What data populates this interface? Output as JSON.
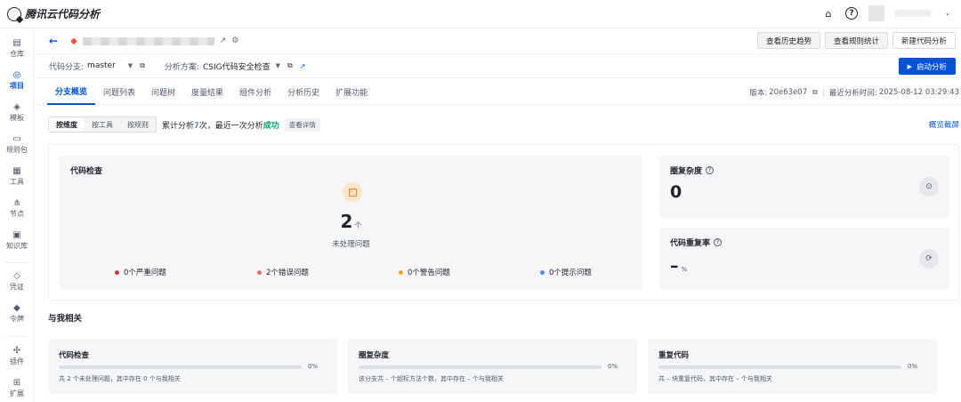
{
  "app": {
    "title": "腾讯云代码分析"
  },
  "nav": [
    {
      "label": "仓库",
      "icon": "repo-icon"
    },
    {
      "label": "项目",
      "icon": "project-icon",
      "active": true
    },
    {
      "label": "模板",
      "icon": "template-icon"
    },
    {
      "label": "规则包",
      "icon": "ruleset-icon"
    },
    {
      "label": "工具",
      "icon": "tools-icon"
    },
    {
      "label": "节点",
      "icon": "node-icon"
    },
    {
      "label": "知识库",
      "icon": "knowledge-icon"
    },
    {
      "label": "凭证",
      "icon": "credential-icon"
    },
    {
      "label": "令牌",
      "icon": "token-icon"
    },
    {
      "label": "插件",
      "icon": "plugin-icon"
    },
    {
      "label": "扩展",
      "icon": "extension-icon"
    }
  ],
  "header_buttons": {
    "history": "查看历史趋势",
    "rules": "查看规则统计",
    "new": "新建代码分析"
  },
  "branch": {
    "label": "代码分支:",
    "value": "master"
  },
  "scheme": {
    "label": "分析方案:",
    "value": "CSIG代码安全检查"
  },
  "start_button": "启动分析",
  "tabs": [
    "分支概览",
    "问题列表",
    "问题树",
    "度量结果",
    "组件分析",
    "分析历史",
    "扩展功能"
  ],
  "version": {
    "label": "版本:",
    "value": "20e63e07"
  },
  "last_analysis": {
    "label": "最近分析时间:",
    "value": "2025-08-12 03:29:43"
  },
  "segments": [
    "按维度",
    "按工具",
    "按规则"
  ],
  "summary": {
    "prefix": "累计分析",
    "count": "7",
    "mid": "次，最近一次分析",
    "status": "成功",
    "detail": "查看详情"
  },
  "screenshot_link": "概览截屏",
  "code_check": {
    "title": "代码检查",
    "total": "2",
    "unit": "个",
    "subtitle": "未处理问题",
    "issues": [
      {
        "label": "0个严重问题",
        "color": "#c9353f"
      },
      {
        "label": "2个错误问题",
        "color": "#f36d6d"
      },
      {
        "label": "0个警告问题",
        "color": "#f5a623"
      },
      {
        "label": "0个提示问题",
        "color": "#4a8df8"
      }
    ]
  },
  "complexity": {
    "title": "圈复杂度",
    "value": "0"
  },
  "duplication": {
    "title": "代码重复率",
    "value": "–",
    "unit": "%"
  },
  "related": {
    "title": "与我相关",
    "cards": [
      {
        "title": "代码检查",
        "percent": 0,
        "percent_label": "0%",
        "desc": "共 2 个未处理问题，其中存在 0 个与我相关"
      },
      {
        "title": "圈复杂度",
        "percent": 0,
        "percent_label": "0%",
        "desc": "该分支共 – 个超标方法个数，其中存在 – 个与我相关"
      },
      {
        "title": "重复代码",
        "percent": 0,
        "percent_label": "0%",
        "desc": "共 – 块重复代码，其中存在 – 个与我相关"
      }
    ]
  },
  "colors": {
    "accent": "#0052d9",
    "success": "#00a870"
  }
}
